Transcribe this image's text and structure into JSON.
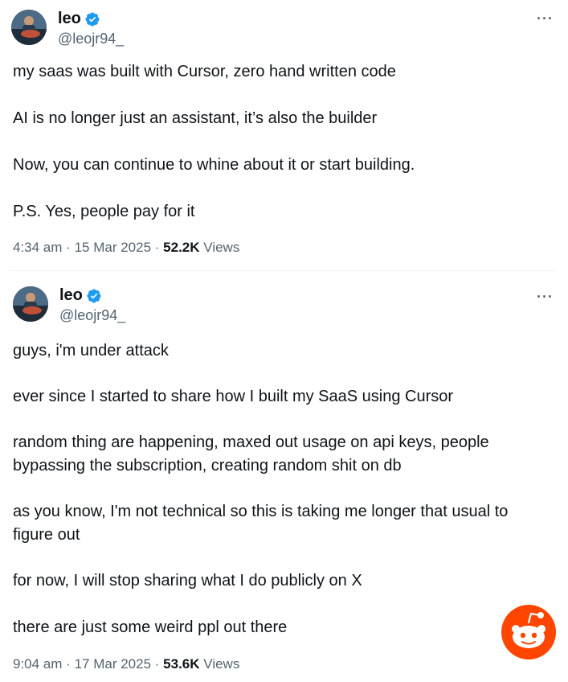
{
  "tweets": [
    {
      "author": {
        "name": "leo",
        "handle": "@leojr94_"
      },
      "more_label": "···",
      "paragraphs": [
        "my saas was built with Cursor, zero hand written code",
        "AI is no longer just an assistant, it’s also the builder",
        "Now, you can continue to whine about it or start building.",
        "P.S. Yes, people pay for it"
      ],
      "time": "4:34 am",
      "date": "15 Mar 2025",
      "views_count": "52.2K",
      "views_label": "Views"
    },
    {
      "author": {
        "name": "leo",
        "handle": "@leojr94_"
      },
      "more_label": "···",
      "paragraphs": [
        "guys, i'm under attack",
        "ever since I started to share how I built my SaaS using Cursor",
        "random thing are happening, maxed out usage on api keys, people bypassing the subscription, creating random shit on db",
        "as you know, I'm not technical so this is taking me longer that usual to figure out",
        "for now, I will stop sharing what I do publicly on X",
        "there are just some weird ppl out there"
      ],
      "time": "9:04 am",
      "date": "17 Mar 2025",
      "views_count": "53.6K",
      "views_label": "Views"
    }
  ],
  "meta_separator": "·",
  "colors": {
    "text": "#0f1419",
    "secondary": "#536471",
    "verified": "#1d9bf0",
    "reddit": "#ff4500"
  },
  "icons": {
    "verified": "verified-badge-icon",
    "more": "more-options-icon",
    "watermark": "reddit-logo-icon"
  }
}
